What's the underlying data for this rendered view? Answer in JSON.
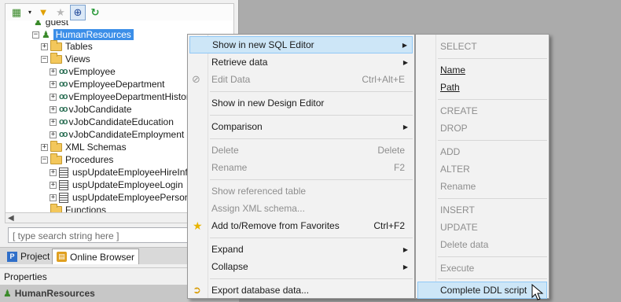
{
  "toolbar": {
    "buttons": [
      "add-icon",
      "filter-icon",
      "star-icon",
      "crosshair-icon",
      "refresh-icon"
    ]
  },
  "tree": {
    "guest": "guest",
    "schema": "HumanResources",
    "tables": "Tables",
    "views": "Views",
    "view_items": [
      "vEmployee",
      "vEmployeeDepartment",
      "vEmployeeDepartmentHistor",
      "vJobCandidate",
      "vJobCandidateEducation",
      "vJobCandidateEmployment"
    ],
    "xml_schemas": "XML Schemas",
    "procedures": "Procedures",
    "procedure_items": [
      "uspUpdateEmployeeHireInfo",
      "uspUpdateEmployeeLogin",
      "uspUpdateEmployeePersona"
    ],
    "functions": "Functions"
  },
  "search": {
    "placeholder": "[ type search string here ]"
  },
  "tabs": {
    "project": "Project",
    "online_browser": "Online Browser"
  },
  "properties": {
    "header": "Properties",
    "selected": "HumanResources"
  },
  "context_menu": {
    "show_sql": "Show in new SQL Editor",
    "retrieve": "Retrieve data",
    "edit": "Edit Data",
    "edit_shortcut": "Ctrl+Alt+E",
    "show_design": "Show in new Design Editor",
    "comparison": "Comparison",
    "delete": "Delete",
    "delete_shortcut": "Delete",
    "rename": "Rename",
    "rename_shortcut": "F2",
    "show_ref": "Show referenced table",
    "assign_xml": "Assign XML schema...",
    "add_fav": "Add to/Remove from Favorites",
    "add_fav_shortcut": "Ctrl+F2",
    "expand": "Expand",
    "collapse": "Collapse",
    "export": "Export database data..."
  },
  "submenu": {
    "select": "SELECT",
    "name": "Name",
    "path": "Path",
    "create": "CREATE",
    "drop": "DROP",
    "add": "ADD",
    "alter": "ALTER",
    "rename": "Rename",
    "insert": "INSERT",
    "update": "UPDATE",
    "delete_data": "Delete data",
    "execute": "Execute",
    "complete_ddl": "Complete DDL script"
  },
  "colors": {
    "selection": "#3b8ee8",
    "menu_highlight": "#cde6f7"
  }
}
